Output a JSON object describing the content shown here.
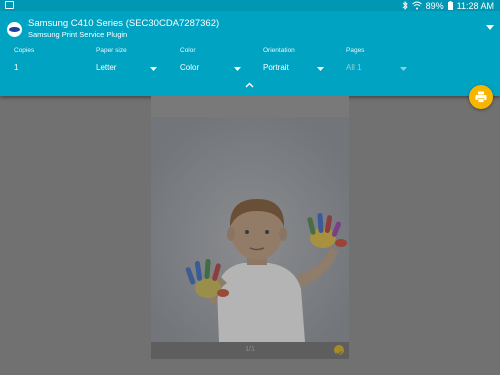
{
  "status_bar": {
    "battery": "89%",
    "time": "11:28 AM",
    "icons": [
      "screenshot-icon",
      "bluetooth-icon",
      "wifi-icon",
      "battery-icon"
    ]
  },
  "printer": {
    "name": "Samsung C410 Series (SEC30CDA7287362)",
    "plugin": "Samsung Print Service Plugin"
  },
  "options": {
    "copies": {
      "label": "Copies",
      "value": "1"
    },
    "paper_size": {
      "label": "Paper size",
      "value": "Letter"
    },
    "color": {
      "label": "Color",
      "value": "Color"
    },
    "orientation": {
      "label": "Orientation",
      "value": "Portrait"
    },
    "pages": {
      "label": "Pages",
      "value": "All 1"
    }
  },
  "preview": {
    "page_number": "1/1",
    "selected": true
  },
  "colors": {
    "header": "#00a3c2",
    "status_bar": "#0097b4",
    "fab": "#f7b500",
    "background": "#717171"
  }
}
